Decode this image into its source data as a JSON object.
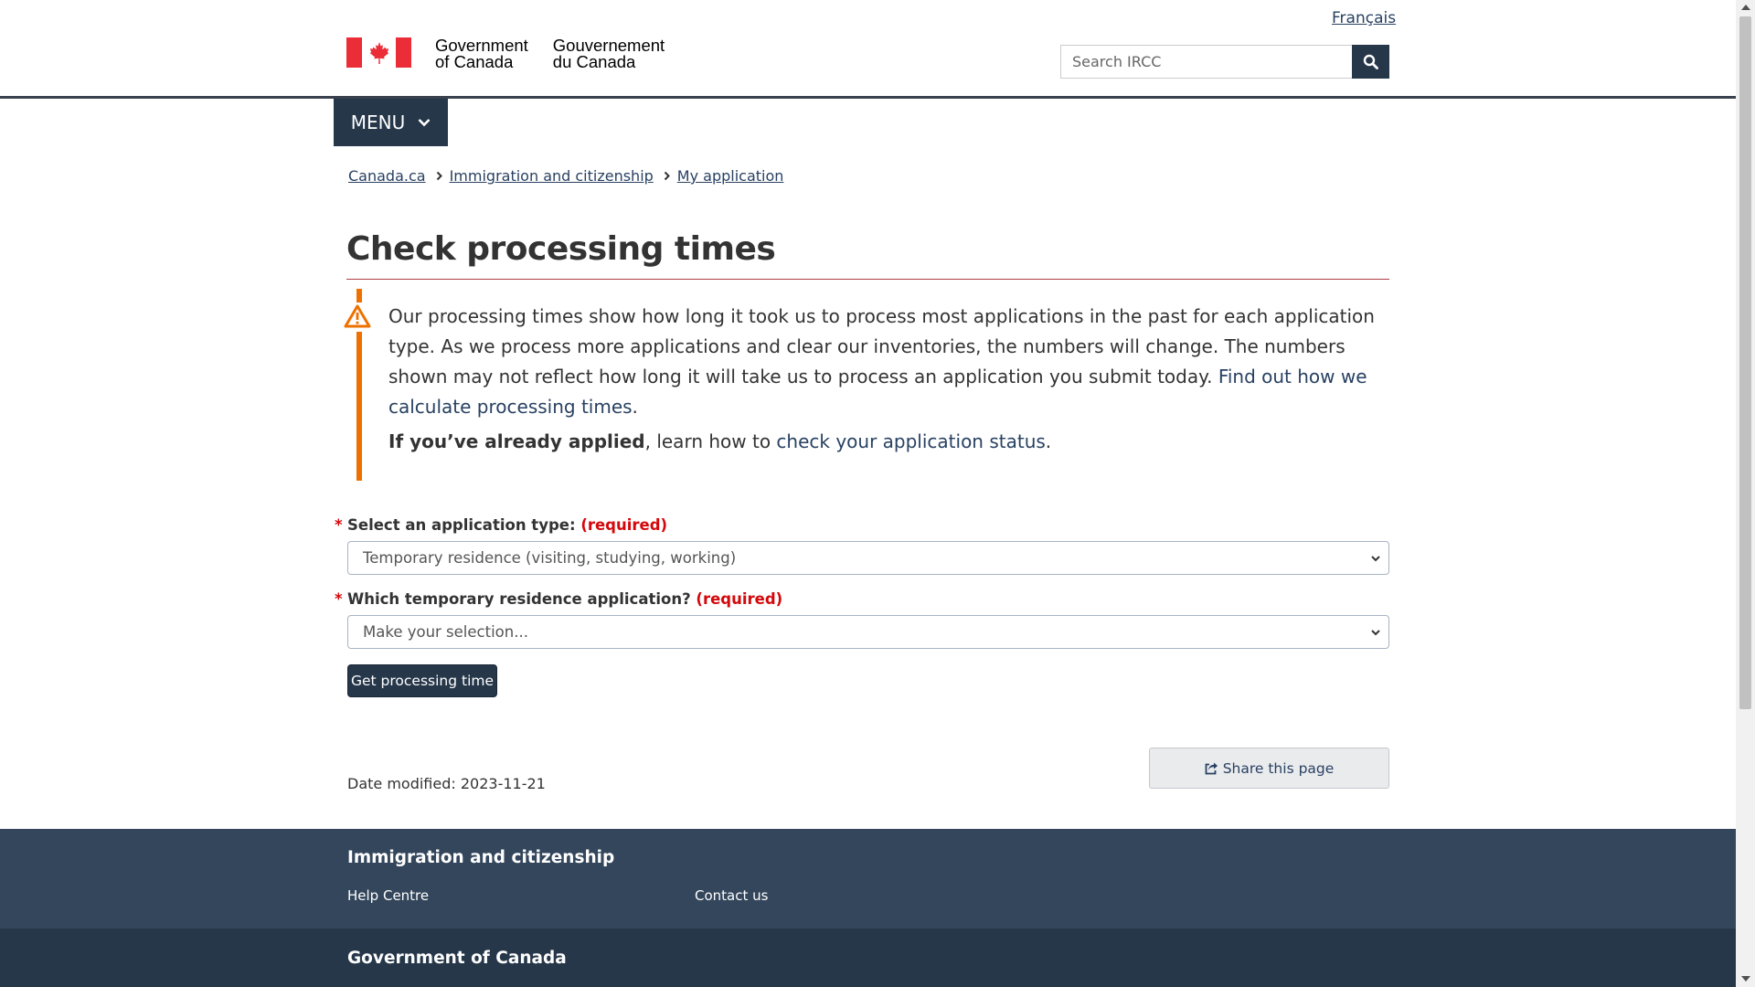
{
  "header": {
    "lang_link": "Français",
    "signature_en_line1": "Government",
    "signature_en_line2": "of Canada",
    "signature_fr_line1": "Gouvernement",
    "signature_fr_line2": "du Canada",
    "search_placeholder": "Search IRCC",
    "menu_label": "MENU"
  },
  "breadcrumb": [
    "Canada.ca",
    "Immigration and citizenship",
    "My application"
  ],
  "page_title": "Check processing times",
  "alert": {
    "text": "Our processing times show how long it took us to process most applications in the past for each application type. As we process more applications and clear our inventories, the numbers will change. The numbers shown may not reflect how long it will take us to process an application you submit today.",
    "link1": "Find out how we calculate processing times",
    "period1": ".",
    "bold": "If you’ve already applied",
    "mid": ", learn how to",
    "link2": "check your application status",
    "period2": "."
  },
  "form": {
    "required_marker": "*",
    "app_type_label": "Select an application type:",
    "required_text": "(required)",
    "app_type_value": "Temporary residence (visiting, studying, working)",
    "temp_label": "Which temporary residence application?",
    "temp_value": "Make your selection...",
    "submit_label": "Get processing time"
  },
  "share_label": "Share this page",
  "date_modified": "Date modified: 2023-11-21",
  "footer": {
    "section_title": "Immigration and citizenship",
    "links": [
      "Help Centre",
      "Contact us"
    ],
    "gov_title": "Government of Canada"
  },
  "colors": {
    "primary": "#26374a",
    "alert_orange": "#ee7100",
    "required_red": "#d3080c",
    "title_rule": "#af3c43",
    "link": "#284162"
  }
}
